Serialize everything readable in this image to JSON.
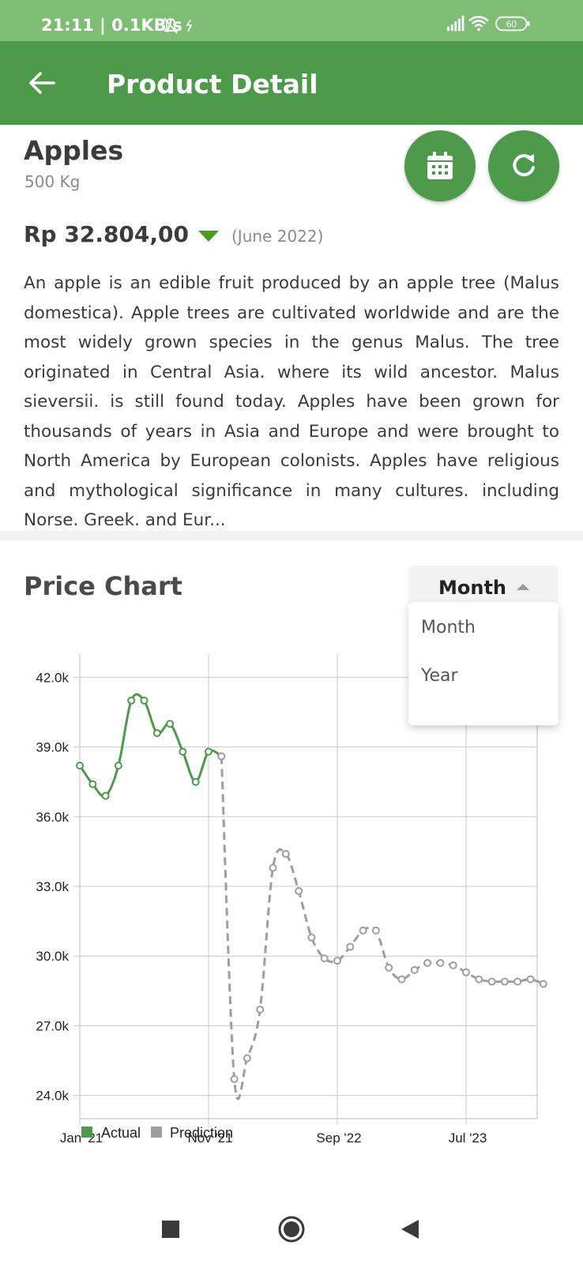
{
  "status_bar": {
    "time": "21:11 | 0.1KB/s",
    "battery": "60"
  },
  "app_bar": {
    "title": "Product Detail",
    "back_icon": "arrow-left-icon"
  },
  "product": {
    "name": "Apples",
    "quantity": "500 Kg",
    "price": "Rp 32.804,00",
    "trend": "down",
    "period": "(June 2022)",
    "description": "An apple is an edible fruit produced by an apple tree (Malus domestica). Apple trees are cultivated worldwide and are the most widely grown species in the genus Malus. The tree originated in Central Asia. where its wild ancestor. Malus sieversii. is still found today. Apples have been grown for thousands of years in Asia and Europe and were brought to North America by European colonists. Apples have religious and mythological significance in many cultures. including Norse. Greek. and Eur..."
  },
  "actions": {
    "calendar_icon": "calendar-icon",
    "refresh_icon": "refresh-icon"
  },
  "price_chart": {
    "title": "Price Chart",
    "selected_period": "Month",
    "options": [
      "Month",
      "Year"
    ]
  },
  "colors": {
    "primary": "#4e9a4b",
    "status_bar": "#7ebd74",
    "actual": "#4e9a4b",
    "prediction": "#9e9e9e"
  },
  "chart_data": {
    "type": "line",
    "x_ticks": [
      "Jan '21",
      "Nov '21",
      "Sep '22",
      "Jul '23"
    ],
    "y_ticks": [
      "42.0k",
      "39.0k",
      "36.0k",
      "33.0k",
      "30.0k",
      "27.0k",
      "24.0k"
    ],
    "ylim": [
      23000,
      43000
    ],
    "x_range_months": [
      0,
      36
    ],
    "grid": true,
    "legend_position": "bottom-left",
    "series": [
      {
        "name": "Actual",
        "style": "solid",
        "x": [
          0,
          1,
          2,
          3,
          4,
          5,
          6,
          7,
          8,
          9,
          10,
          11
        ],
        "y": [
          38200,
          37400,
          36900,
          38200,
          41000,
          41000,
          39600,
          40000,
          38800,
          37500,
          38800,
          38600
        ]
      },
      {
        "name": "Prediction",
        "style": "dashed",
        "x": [
          11,
          12,
          13,
          14,
          15,
          16,
          17,
          18,
          19,
          20,
          21,
          22,
          23,
          24,
          25,
          26,
          27,
          28,
          29,
          30,
          31,
          32,
          33,
          34,
          35,
          36
        ],
        "y": [
          38600,
          24700,
          25600,
          27700,
          33800,
          34400,
          32800,
          30800,
          29900,
          29800,
          30400,
          31100,
          31100,
          29500,
          29000,
          29400,
          29700,
          29700,
          29600,
          29300,
          29000,
          28900,
          28900,
          28900,
          29000,
          28800
        ]
      }
    ]
  },
  "nav_bar": {
    "recents_icon": "square-icon",
    "home_icon": "circle-icon",
    "back_icon": "triangle-back-icon"
  }
}
